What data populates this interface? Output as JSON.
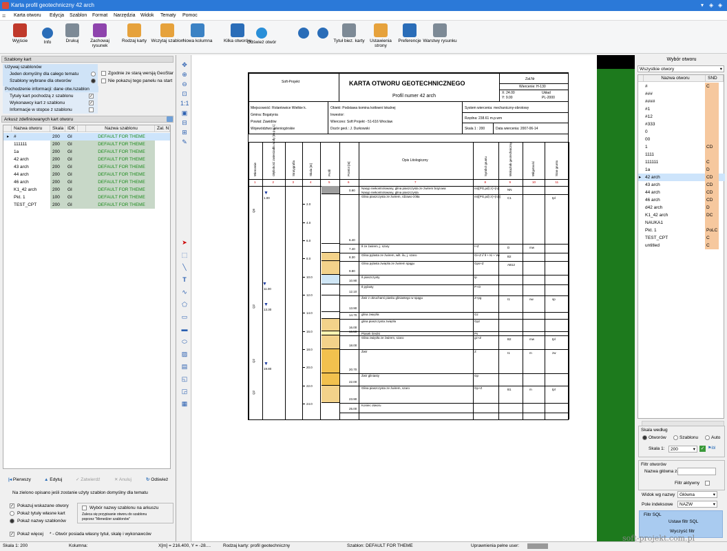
{
  "app": {
    "title": "Karta profil geotechniczny 42 arch"
  },
  "menu": [
    "Karta otworu",
    "Edycja",
    "Szablon",
    "Format",
    "Narzędzia",
    "Widok",
    "Tematy",
    "Pomoc"
  ],
  "toolbar": [
    {
      "label": "Wyjście",
      "icon": "exit-icon",
      "color": "#c0392b"
    },
    {
      "label": "Info",
      "icon": "info-icon",
      "color": "#2a6db8"
    },
    {
      "label": "Drukuj",
      "icon": "printer-icon",
      "color": "#7d8a96"
    },
    {
      "label": "Zachowaj rysunek",
      "icon": "save-drawing-icon",
      "color": "#8e44ad"
    },
    {
      "label": "Rodzaj karty",
      "icon": "card-type-icon",
      "color": "#e6a23c"
    },
    {
      "label": "Wczytaj szablon",
      "icon": "folder-open-icon",
      "color": "#e6a23c"
    },
    {
      "label": "Nowa kolumna",
      "icon": "new-column-icon",
      "color": "#3b82c4"
    },
    {
      "label": "Kilka otworów",
      "icon": "multi-holes-icon",
      "color": "#2a6db8"
    },
    {
      "label": "Odśwież otwór",
      "icon": "refresh-icon",
      "color": "#2a8fd8"
    },
    {
      "label": "",
      "icon": "arrow-left-icon",
      "color": "#2a6db8"
    },
    {
      "label": "",
      "icon": "arrow-right-icon",
      "color": "#2a6db8"
    },
    {
      "label": "Tytuł biez. karty",
      "icon": "title-icon",
      "color": "#7d8a96"
    },
    {
      "label": "Ustawienia strony",
      "icon": "page-setup-icon",
      "color": "#e6a23c"
    },
    {
      "label": "Preferencje",
      "icon": "preferences-icon",
      "color": "#2a6db8"
    },
    {
      "label": "Warstwy rysunku",
      "icon": "layers-icon",
      "color": "#7d8a96"
    }
  ],
  "left": {
    "section1": "Szablony kart",
    "group1_title": "Używaj szablonów",
    "group1_items": [
      "Jeden domyślny dla całego tematu",
      "Szablony wybrane dla otworów"
    ],
    "opt_compat": "Zgodnie ze starą wersją GeoStar",
    "opt_hide": "Nie pokazuj tego panelu na start",
    "group2_title": "Pochodzenie informacji: dane otw./szablon",
    "group2_items": [
      "Tytuły kart pochodzą z szablonu",
      "Wykonawcy kart z szablonu",
      "Informacje w stopce z szablonu"
    ],
    "section2": "Arkusz zdefiniowanych kart otworu",
    "columns": [
      "Nazwa otworu",
      "Skala",
      "IDK",
      "",
      "Nazwa szablonu",
      "Zal. N"
    ],
    "rows": [
      {
        "name": "#",
        "scale": "200",
        "idk": "GI",
        "tmpl": "DEFAULT FOR THEME"
      },
      {
        "name": "111111",
        "scale": "200",
        "idk": "GI",
        "tmpl": "DEFAULT FOR THEME"
      },
      {
        "name": "1a",
        "scale": "200",
        "idk": "GI",
        "tmpl": "DEFAULT FOR THEME"
      },
      {
        "name": "42 arch",
        "scale": "200",
        "idk": "GI",
        "tmpl": "DEFAULT FOR THEME"
      },
      {
        "name": "43 arch",
        "scale": "200",
        "idk": "GI",
        "tmpl": "DEFAULT FOR THEME"
      },
      {
        "name": "44 arch",
        "scale": "200",
        "idk": "GI",
        "tmpl": "DEFAULT FOR THEME"
      },
      {
        "name": "46 arch",
        "scale": "200",
        "idk": "GI",
        "tmpl": "DEFAULT FOR THEME"
      },
      {
        "name": "K1_42 arch",
        "scale": "200",
        "idk": "GI",
        "tmpl": "DEFAULT FOR THEME"
      },
      {
        "name": "Pkt. 1",
        "scale": "100",
        "idk": "GI",
        "tmpl": "DEFAULT FOR THEME"
      },
      {
        "name": "TEST_CPT",
        "scale": "200",
        "idk": "GI",
        "tmpl": "DEFAULT FOR THEME"
      }
    ],
    "buttons": [
      "Pierwszy",
      "Edytuj",
      "Zatwierdź",
      "Anuluj",
      "Odśwież"
    ],
    "note": "Na zielono opisano jeśli zostanie użyty szablon domyślny dla tematu",
    "show_template": "Pokazuj wskazane otwory",
    "show_title": "Pokaż tytuły własne kart",
    "show_names": "Pokaż nazwy szablonów",
    "choose_sheet": "Wybór nazwy szablonu na arkuszu",
    "choose_hint1": "Zaleca się przypisanie otworu do szablonu",
    "choose_hint2": "poprzez \"Menedżer szablonów\"",
    "show_more": "Pokaż więcej",
    "more_hint": "* - Otwór posiada własny tytuł, skalę i wykonawców"
  },
  "sheet": {
    "company": "Soft-Projekt",
    "title": "KARTA OTWORU GEOTECHNICZNEGO",
    "subtitle": "Profil numer 42 arch",
    "zal": "Zał.Nr",
    "wiercenie": "Wiercenie: H-130",
    "xcoord": "X: 24.00",
    "ycoord": "Y: 9.00",
    "uklad_l": "Układ",
    "uklad_v": "PL-2000",
    "miejscowosc": "Miejscowość: Rolantowice Wielkie k.",
    "gmina": "Gmina: Bogatynia",
    "powiat": "Powiat: Zawidów",
    "woj": "Województwo: jeleniogórskie",
    "obiekt": "Obiekt: Podstawa komina kotłowni lokalnej",
    "inwestor": "Inwestor:",
    "wiercono": "Wiercono: Soft Projekt - 51-616 Wrocław",
    "dozor": "Dozór geol.: J. Durkowski",
    "system": "System wiercenia: mechaniczny-obrotowy",
    "rzedna": "Rzędna: 238.61 m.p.wm",
    "skala": "Skala 1 : 200",
    "data": "Data wiercenia: 2007-06-14",
    "col_headers": [
      "Wiercenie",
      "Głębokość zwierciadła wody [m p.p.t.]",
      "Stratygrafia",
      "Skala [m]",
      "Profil",
      "Przelot [m]",
      "Opis Litologiczny",
      "Symbol gruntu",
      "Wskaźnik geotechniczny",
      "Wilgotność",
      "Stan gruntu"
    ],
    "col_nums": [
      "1",
      "2",
      "3",
      "4",
      "5",
      "6",
      "7",
      "8",
      "9",
      "10",
      "11"
    ],
    "depth_marks": [
      "2.0",
      "4.0",
      "6.0",
      "8.0",
      "10.0",
      "12.0",
      "14.0",
      "16.0",
      "18.0",
      "20.0",
      "22.0",
      "24.0"
    ],
    "layers": [
      {
        "depth": "0.90",
        "desc": "Nasyp niekontrolowany, glina piaszczysta ze żwirem brązowa",
        "desc2": "Nasyp niekontrolowany, glina piaszczysta",
        "sym": "nn[(PG,pd) z(+(n)]",
        "wsk": "NN",
        "wil": "",
        "stan": ""
      },
      {
        "depth": "6.40",
        "desc": "Glina piaszczysta ze żwirem, rdzawo-żółta",
        "sym": "nn[(PG,pd) z(+(n))]",
        "wsk": "C1",
        "wil": "",
        "stan": "tpl"
      },
      {
        "depth": "7.40",
        "desc": "Ił ze żwirem, j. szary",
        "sym": "I+Z",
        "wsk": "D",
        "wil": "mw",
        "stan": ""
      },
      {
        "depth": "8.30",
        "desc": "Glina pylasta ze żwirem, wilt. ilu, j. szaro",
        "sym": "Gi+Z // Ił + Ki + Wi",
        "wsk": "B2",
        "wil": "",
        "stan": ""
      },
      {
        "depth": "9.80",
        "desc": "Glina pylasta zwięzła ze żwirem spągu",
        "sym": "Gps+Z",
        "wsk": "AB12",
        "wil": "",
        "stan": ""
      },
      {
        "depth": "10.90",
        "desc": "Ił piaszczysty",
        "sym": "Ip",
        "wsk": "",
        "wil": "",
        "stan": ""
      },
      {
        "depth": "12.10",
        "desc": "Ił pylasty",
        "sym": "P+O",
        "wsk": "",
        "wil": "",
        "stan": ""
      },
      {
        "depth": "13.90",
        "desc": "Żwir z okruchami piasku gliniastego w spągu",
        "sym": "Z+pg",
        "wsk": "I1",
        "wil": "nw",
        "stan": "sp"
      },
      {
        "depth": "14.70",
        "desc": "glina zwięzła",
        "sym": "Gz",
        "wsk": "",
        "wil": "",
        "stan": ""
      },
      {
        "depth": "16.00",
        "desc": "glina piaszczysta zwięzła",
        "sym": "Gpz",
        "wsk": "",
        "wil": "",
        "stan": ""
      },
      {
        "depth": "16.50",
        "desc": "Piasek średni",
        "sym": "Ps",
        "wsk": "",
        "wil": "",
        "stan": ""
      },
      {
        "depth": "18.00",
        "desc": "Glina zwięzła ze żwirem, szaro",
        "sym": "gz+Z",
        "wsk": "B2",
        "wil": "mw",
        "stan": "tpl"
      },
      {
        "depth": "20.70",
        "desc": "Żwir",
        "sym": "Z",
        "wsk": "I1",
        "wil": "m",
        "stan": "zw"
      },
      {
        "depth": "22.00",
        "desc": "Żwir gliniasty",
        "sym": "Gp",
        "wsk": "",
        "wil": "",
        "stan": ""
      },
      {
        "depth": "23.90",
        "desc": "Glina piaszczysta ze żwirem, szaro",
        "sym": "Gp+Z",
        "wsk": "B1",
        "wil": "m",
        "stan": "tpl"
      },
      {
        "depth": "25.00",
        "desc": "Koniec otworu",
        "sym": "",
        "wsk": "",
        "wil": "",
        "stan": ""
      }
    ],
    "water_levels": [
      "1.00",
      "11.00",
      "13.30",
      "19.80"
    ],
    "strat_labels": [
      "Q6",
      "Q2",
      "Q2",
      "Q2"
    ]
  },
  "right": {
    "title": "Wybór otworu",
    "filter": "Wszystkie otwory",
    "columns": [
      "Nazwa otworu",
      "SND"
    ],
    "rows": [
      {
        "n": "#",
        "d": "C"
      },
      {
        "n": "###",
        "d": ""
      },
      {
        "n": "####",
        "d": ""
      },
      {
        "n": "#1",
        "d": ""
      },
      {
        "n": "#12",
        "d": ""
      },
      {
        "n": "#333",
        "d": ""
      },
      {
        "n": "0",
        "d": ""
      },
      {
        "n": "00",
        "d": ""
      },
      {
        "n": "1",
        "d": "CD"
      },
      {
        "n": "1111",
        "d": ""
      },
      {
        "n": "111111",
        "d": "C"
      },
      {
        "n": "1a",
        "d": "D"
      },
      {
        "n": "42 arch",
        "d": "CD"
      },
      {
        "n": "43 arch",
        "d": "CD"
      },
      {
        "n": "44 arch",
        "d": "CD"
      },
      {
        "n": "46 arch",
        "d": "CD"
      },
      {
        "n": "d42 arch",
        "d": "D"
      },
      {
        "n": "K1_42 arch",
        "d": "DC"
      },
      {
        "n": "NAUKA1",
        "d": ""
      },
      {
        "n": "Pkt. 1",
        "d": "PoLC"
      },
      {
        "n": "TEST_CPT",
        "d": "C"
      },
      {
        "n": "untitled",
        "d": "C"
      }
    ],
    "scale_title": "Skala według",
    "scale_opts": [
      "Otworów",
      "Szablonu",
      "Auto"
    ],
    "scale_label": "Skala 1:",
    "scale_value": "200",
    "filter_title": "Filtr otworów",
    "name_contains": "Nazwa główna zawiera",
    "filter_active": "Filtr aktywny",
    "view_by": "Widok wg nazwy",
    "view_val": "Główna",
    "pole_label": "Pole indeksowe",
    "pole_val": "NAZW",
    "sql_title": "Filtr SQL",
    "sql_set": "Ustaw filtr SQL",
    "sql_clear": "Wyczyść filtr"
  },
  "status": {
    "skala": "Skala 1: 200",
    "kolumna": "Kolumna:",
    "xy": "X[m] = 216.400, Y = -28....",
    "rodzaj": "Rodzaj karty: profil geotechniczny",
    "szablon": "Szablon: DEFAULT FOR THEME",
    "upr": "Uprawnienia pełne user:",
    "watermark": "soft-projekt.com.pl"
  }
}
